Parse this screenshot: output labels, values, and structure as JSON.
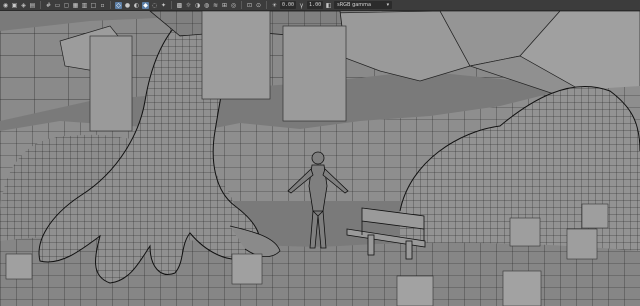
{
  "toolbar": {
    "field_exposure": "0.00",
    "field_gamma": "1.00",
    "color_management": "sRGB gamma",
    "icons": [
      "camera-select-icon",
      "lock-camera-icon",
      "bookmarks-icon",
      "image-plane-icon",
      "grid-icon",
      "film-gate-icon",
      "resolution-gate-icon",
      "gate-mask-icon",
      "field-chart-icon",
      "safe-action-icon",
      "safe-title-icon",
      "wireframe-icon",
      "smooth-shade-icon",
      "use-default-material-icon",
      "wireframe-on-shaded-icon",
      "xray-icon",
      "xray-joints-icon",
      "textured-icon",
      "lights-icon",
      "shadows-icon",
      "screen-space-ao-icon",
      "motion-blur-icon",
      "multisample-aa-icon",
      "depth-of-field-icon",
      "isolate-select-icon",
      "xray-active-icon",
      "exposure-icon",
      "gamma-icon",
      "color-management-icon"
    ]
  },
  "scene": {
    "background_color": "#7e7e7e",
    "mesh_fill": "#8c8c8c",
    "wire_color": "#1a1a1a",
    "card_color": "#9a9a9a",
    "objects": [
      "tree-trunk-mesh",
      "terrain-mesh",
      "rock-left",
      "rock-right",
      "human-figure",
      "park-bench",
      "foliage-cards"
    ]
  }
}
